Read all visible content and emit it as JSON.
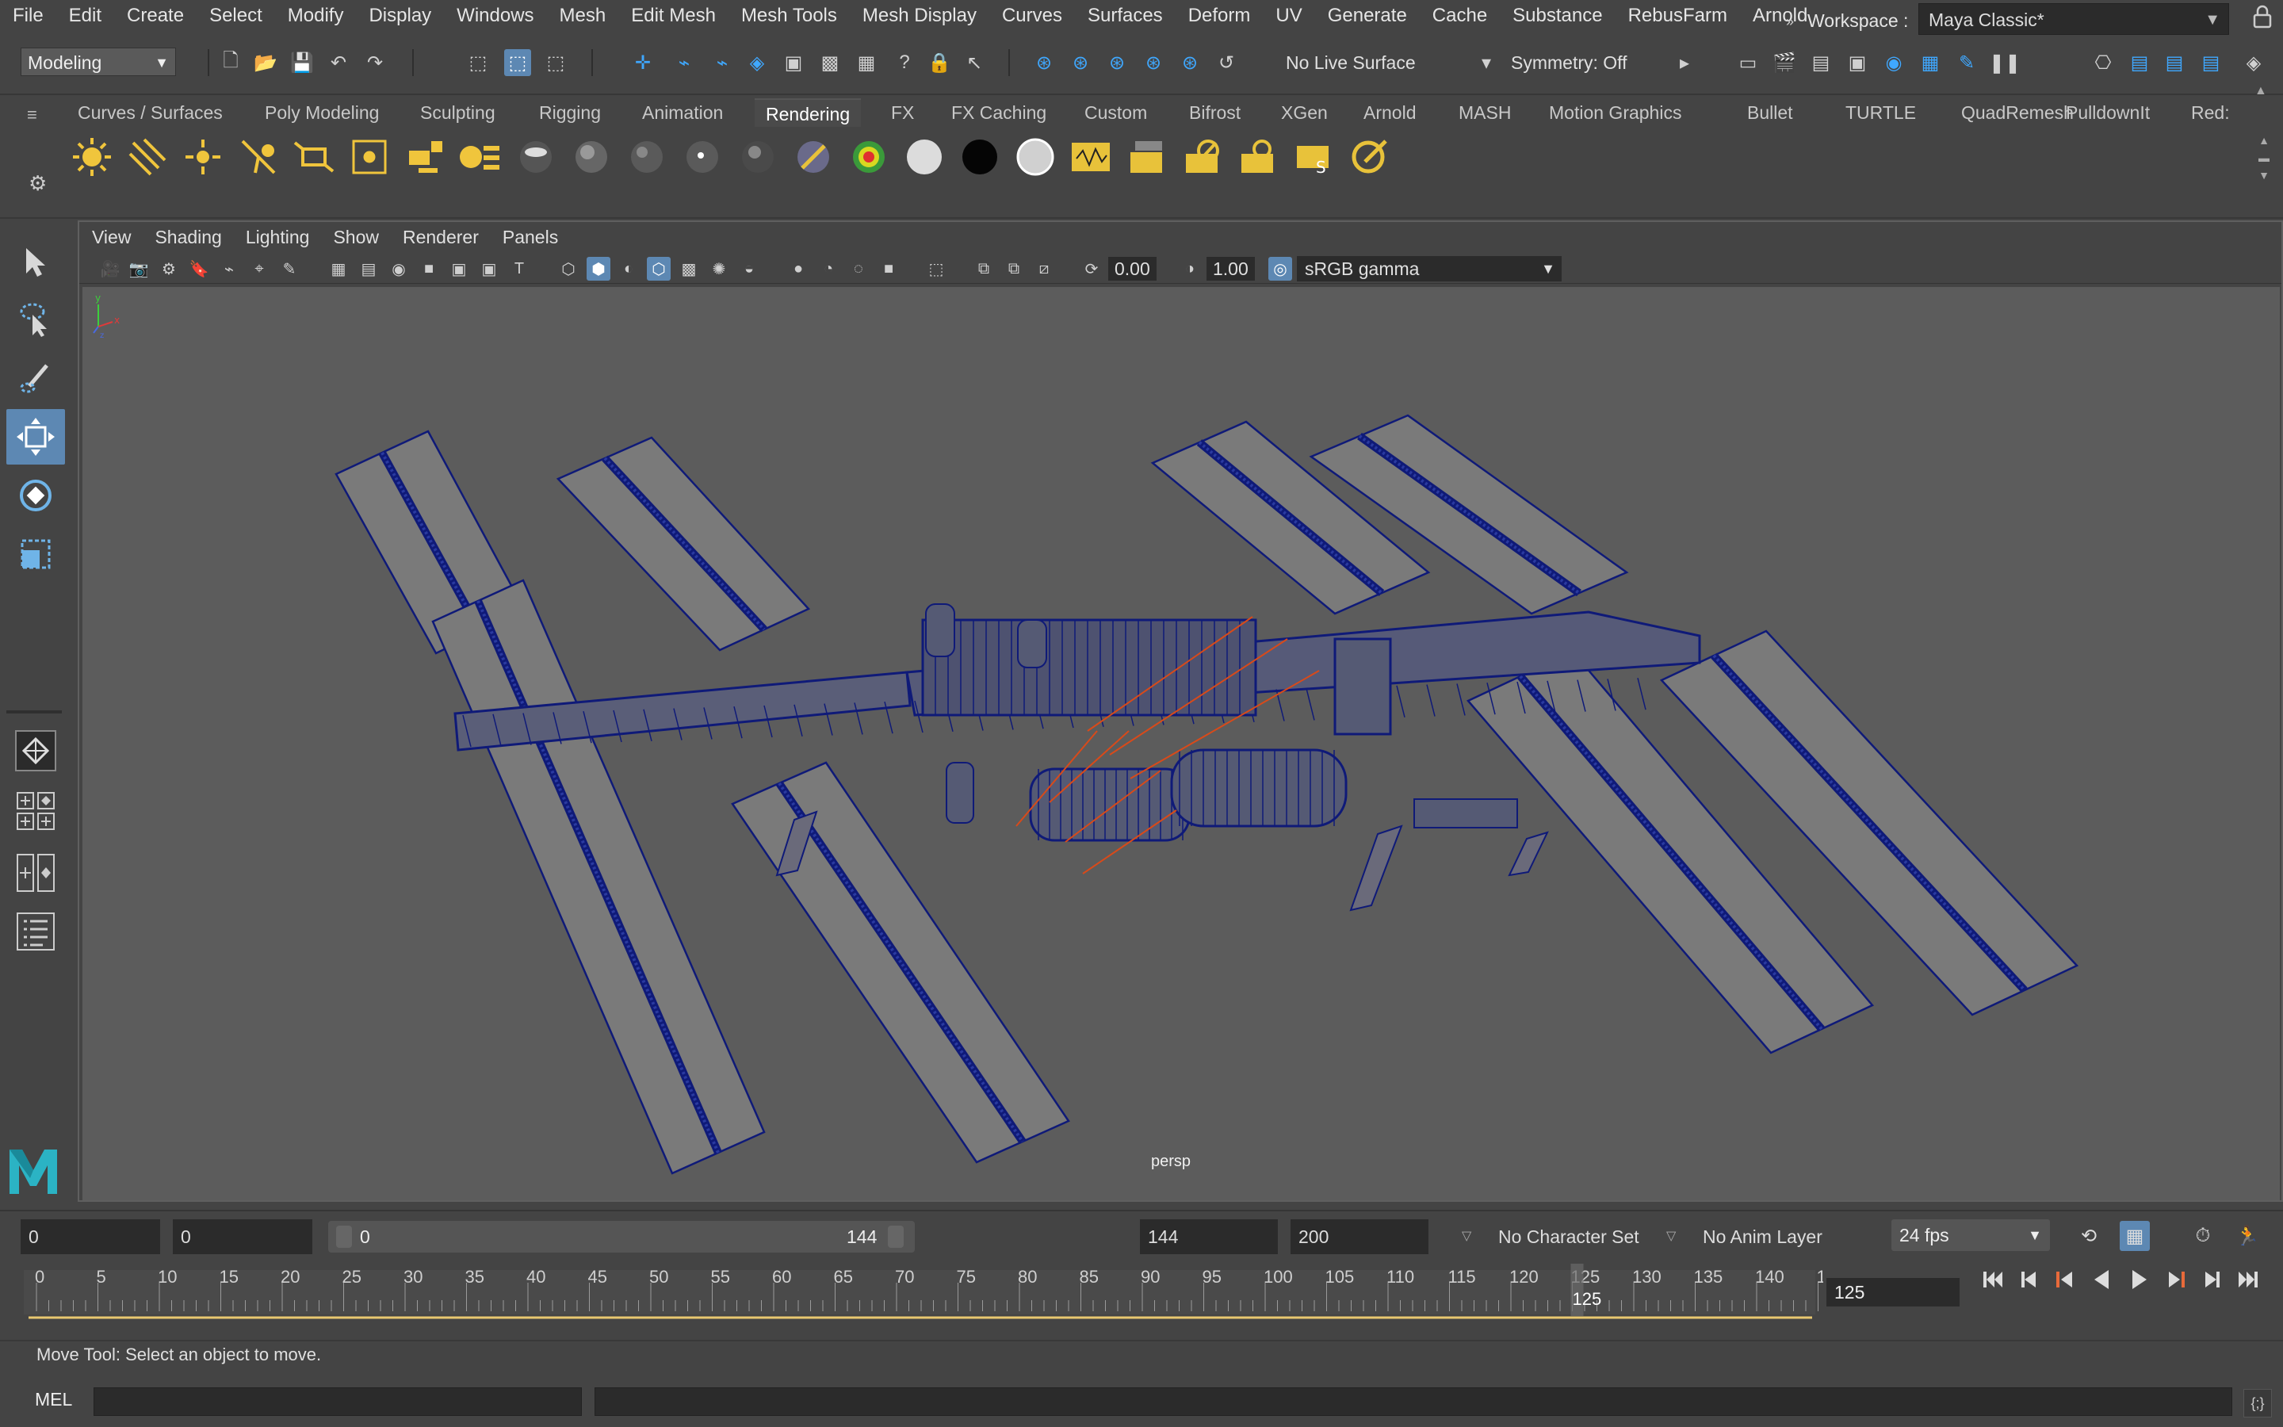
{
  "menubar": {
    "items": [
      "File",
      "Edit",
      "Create",
      "Select",
      "Modify",
      "Display",
      "Windows",
      "Mesh",
      "Edit Mesh",
      "Mesh Tools",
      "Mesh Display",
      "Curves",
      "Surfaces",
      "Deform",
      "UV",
      "Generate",
      "Cache",
      "Substance",
      "RebusFarm",
      "Arnold"
    ],
    "workspace_marker": "»",
    "workspace_label": "Workspace :",
    "workspace_value": "Maya Classic*"
  },
  "status_line": {
    "mode": "Modeling",
    "live_surface": "No Live Surface",
    "symmetry": "Symmetry: Off"
  },
  "shelf": {
    "tabs": [
      "Curves / Surfaces",
      "Poly Modeling",
      "Sculpting",
      "Rigging",
      "Animation",
      "Rendering",
      "FX",
      "FX Caching",
      "Custom",
      "Bifrost",
      "XGen",
      "Arnold",
      "MASH",
      "Motion Graphics",
      "Bullet",
      "TURTLE",
      "QuadRemesh",
      "PulldownIt",
      "Red:"
    ],
    "active_tab": "Rendering",
    "icons": [
      "ambient-light-icon",
      "directional-light-icon",
      "point-light-icon",
      "spot-light-icon",
      "area-light-icon",
      "volume-light-icon",
      "create-camera-icon",
      "camera-aim-icon",
      "blinn-sphere-icon",
      "lambert-sphere-icon",
      "phong-sphere-icon",
      "phong-e-sphere-icon",
      "anisotropic-sphere-icon",
      "layered-shader-icon",
      "ramp-shader-icon",
      "surface-shader-white-icon",
      "use-background-icon",
      "standard-surface-icon",
      "hypershade-icon",
      "render-view-icon",
      "render-current-icon",
      "ipr-render-icon",
      "render-settings-icon",
      "batch-render-icon"
    ]
  },
  "panel": {
    "menus": [
      "View",
      "Shading",
      "Lighting",
      "Show",
      "Renderer",
      "Panels"
    ],
    "exposure": "0.00",
    "gamma": "1.00",
    "color_space": "sRGB gamma",
    "camera_label": "persp",
    "wireframe_color": "#0f1a78",
    "panel_color": "#7a7a7a",
    "bg_color": "#5c5c5c"
  },
  "time_slider": {
    "range_start": "0",
    "anim_start": "0",
    "range_min": "0",
    "range_max": "144",
    "anim_end": "144",
    "end_time": "200",
    "character_set": "No Character Set",
    "anim_layer": "No Anim Layer",
    "fps": "24 fps",
    "current_frame": "125",
    "current_frame_label": "125",
    "ticks": [
      "0",
      "5",
      "10",
      "15",
      "20",
      "25",
      "30",
      "35",
      "40",
      "45",
      "50",
      "55",
      "60",
      "65",
      "70",
      "75",
      "80",
      "85",
      "90",
      "95",
      "100",
      "105",
      "110",
      "115",
      "120",
      "125",
      "130",
      "135",
      "140",
      "1"
    ]
  },
  "help_line": {
    "text": "Move Tool: Select an object to move."
  },
  "command_line": {
    "label": "MEL",
    "script_button": "{;}"
  },
  "colors": {
    "accent": "#5d88b3",
    "ui_bg": "#444444",
    "field_bg": "#2b2b2b",
    "shelf_yellow": "#e8c23a",
    "range_line": "#e8c870"
  }
}
